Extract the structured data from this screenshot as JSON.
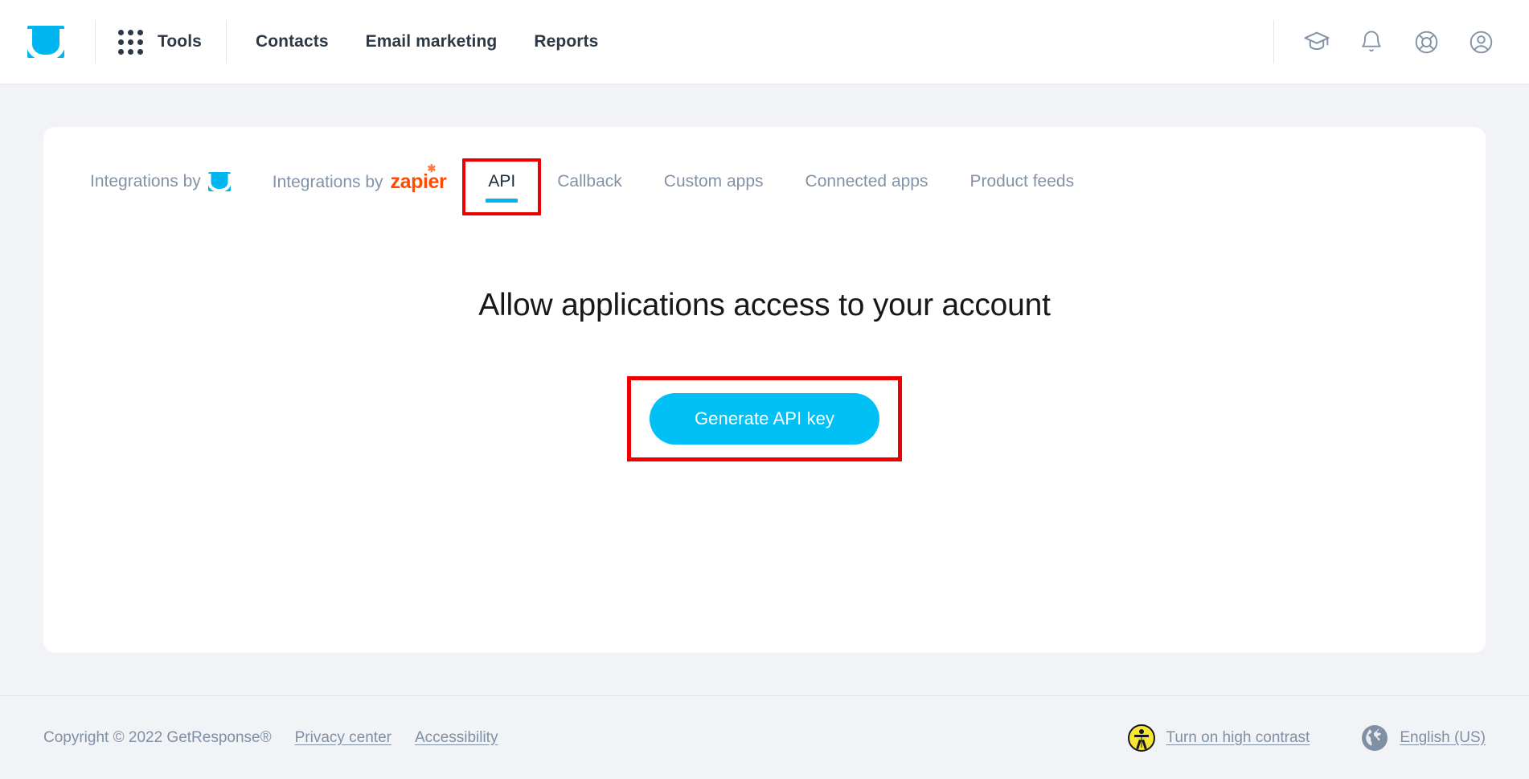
{
  "header": {
    "logo_name": "getresponse-logo",
    "tools_label": "Tools",
    "nav": [
      {
        "label": "Contacts",
        "name": "nav-contacts"
      },
      {
        "label": "Email marketing",
        "name": "nav-email-marketing"
      },
      {
        "label": "Reports",
        "name": "nav-reports"
      }
    ],
    "icons": [
      {
        "name": "graduation-cap-icon",
        "title": "Learning"
      },
      {
        "name": "bell-icon",
        "title": "Notifications"
      },
      {
        "name": "lifebuoy-help-icon",
        "title": "Help"
      },
      {
        "name": "user-account-icon",
        "title": "Account"
      }
    ]
  },
  "tabs": [
    {
      "label": "Integrations by",
      "icon": "getresponse-mark",
      "active": false,
      "highlighted": false
    },
    {
      "label": "Integrations by",
      "icon": "zapier-logo",
      "zapier_text": "zapier",
      "active": false,
      "highlighted": false
    },
    {
      "label": "API",
      "icon": null,
      "active": true,
      "highlighted": true
    },
    {
      "label": "Callback",
      "icon": null,
      "active": false,
      "highlighted": false
    },
    {
      "label": "Custom apps",
      "icon": null,
      "active": false,
      "highlighted": false
    },
    {
      "label": "Connected apps",
      "icon": null,
      "active": false,
      "highlighted": false
    },
    {
      "label": "Product feeds",
      "icon": null,
      "active": false,
      "highlighted": false
    }
  ],
  "main": {
    "heading": "Allow applications access to your account",
    "cta_label": "Generate API key",
    "cta_highlighted": true
  },
  "footer": {
    "copyright": "Copyright © 2022 GetResponse®",
    "privacy_label": "Privacy center",
    "accessibility_label": "Accessibility",
    "high_contrast_label": "Turn on high contrast",
    "language_label": "English (US)"
  },
  "colors": {
    "brand_cyan": "#00b6f0",
    "cta_cyan": "#00c0f5",
    "zapier_orange": "#ff4a00",
    "annotation_red": "#ee0000",
    "page_bg": "#f1f3f7",
    "muted_text": "#8293a8",
    "dark_text": "#2c3845",
    "a11y_yellow": "#f7e733"
  }
}
